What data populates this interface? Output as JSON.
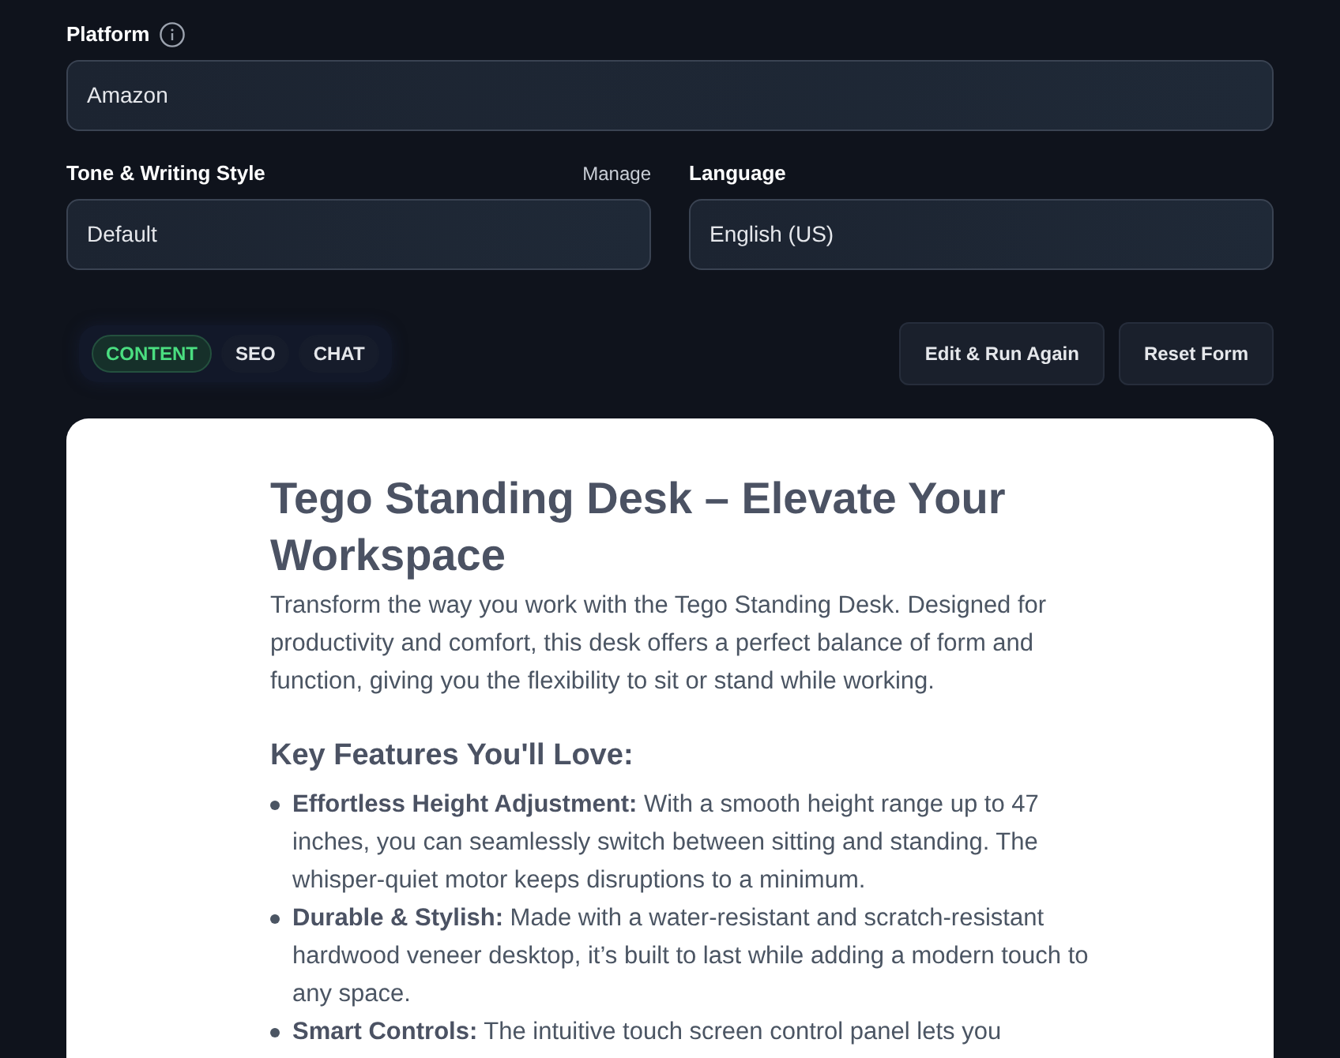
{
  "form": {
    "platform": {
      "label": "Platform",
      "value": "Amazon"
    },
    "tone": {
      "label": "Tone & Writing Style",
      "action": "Manage",
      "value": "Default"
    },
    "language": {
      "label": "Language",
      "value": "English (US)"
    }
  },
  "tabs": [
    {
      "label": "CONTENT",
      "selected": true
    },
    {
      "label": "SEO",
      "selected": false
    },
    {
      "label": "CHAT",
      "selected": false
    }
  ],
  "buttons": [
    "Edit & Run Again",
    "Reset Form"
  ],
  "content": {
    "title": "Tego Standing Desk – Elevate Your Workspace",
    "intro": "Transform the way you work with the Tego Standing Desk. Designed for productivity and comfort, this desk offers a perfect balance of form and function, giving you the flexibility to sit or stand while working.",
    "heading": "Key Features You'll Love:",
    "features": [
      "**Effortless Height Adjustment:** With a smooth height range up to 47 inches, you can seamlessly switch between sitting and standing. The whisper-quiet motor keeps disruptions to a minimum.",
      "**Durable & Stylish:** Made with a water-resistant and scratch-resistant hardwood veneer desktop, it’s built to last while adding a modern touch to any space.",
      "**Smart Controls:** The intuitive touch screen control panel lets you"
    ]
  }
}
